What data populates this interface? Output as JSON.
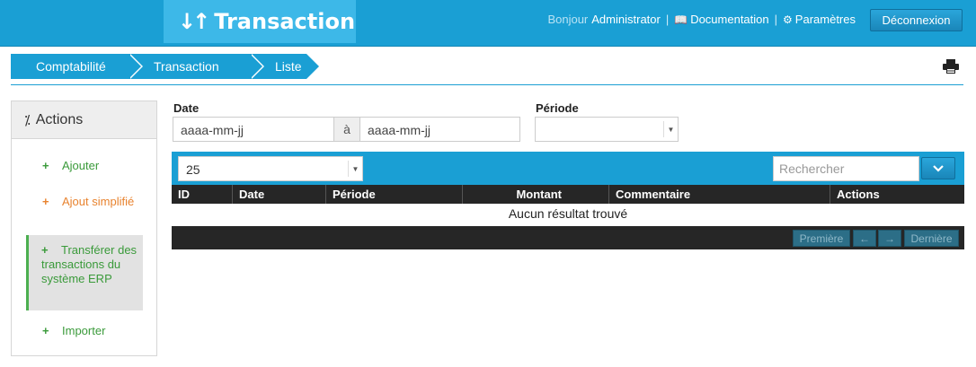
{
  "header": {
    "title": "Transaction",
    "title_icon": "sort-arrows-icon",
    "greeting": "Bonjour",
    "user": "Administrator",
    "documentation": "Documentation",
    "settings": "Paramètres",
    "logout": "Déconnexion",
    "colors": {
      "bar": "#1a9fd4",
      "brand": "#3db8e8"
    }
  },
  "breadcrumb": [
    "Comptabilité",
    "Transaction",
    "Liste"
  ],
  "sidebar": {
    "title": "Actions",
    "items": [
      {
        "label": "Ajouter",
        "color": "green"
      },
      {
        "label": "Ajout simplifié",
        "color": "orange"
      },
      {
        "label": "Transférer des transactions du système ERP",
        "color": "green",
        "active": true
      },
      {
        "label": "Importer",
        "color": "green"
      }
    ]
  },
  "filters": {
    "date_label": "Date",
    "date_from_placeholder": "aaaa-mm-jj",
    "date_separator": "à",
    "date_to_placeholder": "aaaa-mm-jj",
    "period_label": "Période",
    "period_value": ""
  },
  "table": {
    "page_size": "25",
    "search_placeholder": "Rechercher",
    "columns": [
      "ID",
      "Date",
      "Période",
      "Montant",
      "Commentaire",
      "Actions"
    ],
    "empty_message": "Aucun résultat trouvé",
    "pagination": {
      "first": "Première",
      "prev": "←",
      "next": "→",
      "last": "Dernière"
    }
  }
}
